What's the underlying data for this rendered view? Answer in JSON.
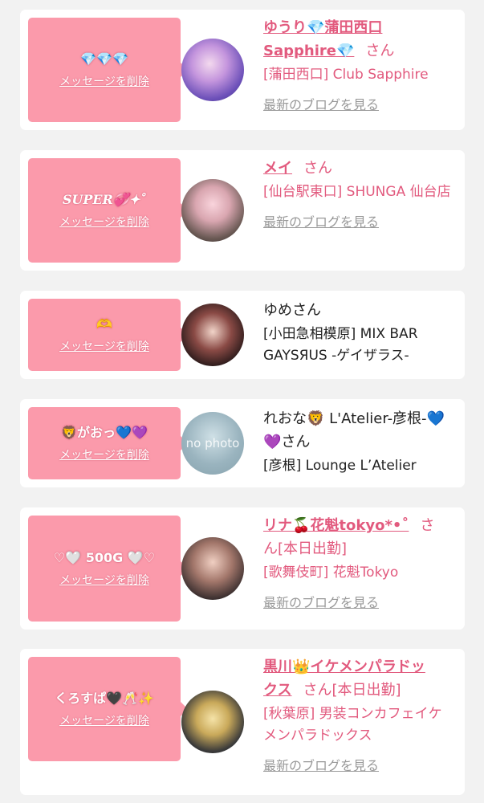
{
  "cards": [
    {
      "message": "💎💎💎",
      "delete_label": "メッセージを削除",
      "name_link": "ゆうり💎蒲田西口Sapphire💎",
      "name_link_a": "ゆうり💎蒲田西口",
      "name_link_b": "Sapphire💎",
      "san": "さん",
      "shop": "[蒲田西口] Club Sapphire",
      "blog": "最新のブログを見る"
    },
    {
      "message": "SUPER💞✦˚",
      "delete_label": "メッセージを削除",
      "name_link": "メイ",
      "san": "さん",
      "shop": "[仙台駅東口] SHUNGA 仙台店",
      "blog": "最新のブログを見る"
    },
    {
      "message": "🫶",
      "delete_label": "メッセージを削除",
      "name_plain": "ゆめさん",
      "shop": "[小田急相模原] MIX BAR GAYSЯUS -ゲイザラス-"
    },
    {
      "message": "🦁がおっ💙💜",
      "delete_label": "メッセージを削除",
      "name_plain": "れおな🦁 L'Atelier-彦根-💙💜さん",
      "avatar_text": "no photo",
      "shop": "[彦根] Lounge L’Atelier"
    },
    {
      "message": "♡🤍 500G 🤍♡",
      "delete_label": "メッセージを削除",
      "name_link": "リナ🍒花魁tokyo*•˚",
      "san": "さ",
      "san_tail": "ん",
      "badge": "[本日出勤]",
      "shop": "[歌舞伎町] 花魁Tokyo",
      "blog": "最新のブログを見る"
    },
    {
      "message": "くろすぱ🖤🥂✨",
      "delete_label": "メッセージを削除",
      "name_link_a": "黒川👑イケメンパラドッ",
      "name_link_b": "クス",
      "san": "さん",
      "badge": "[本日出勤]",
      "shop": "[秋葉原] 男装コンカフェイケメンパラドックス",
      "blog": "最新のブログを見る"
    }
  ],
  "colors": {
    "accent_pink": "#e25a7e",
    "bubble_pink": "#fb9aab",
    "page_bg": "#f2f2f2"
  }
}
